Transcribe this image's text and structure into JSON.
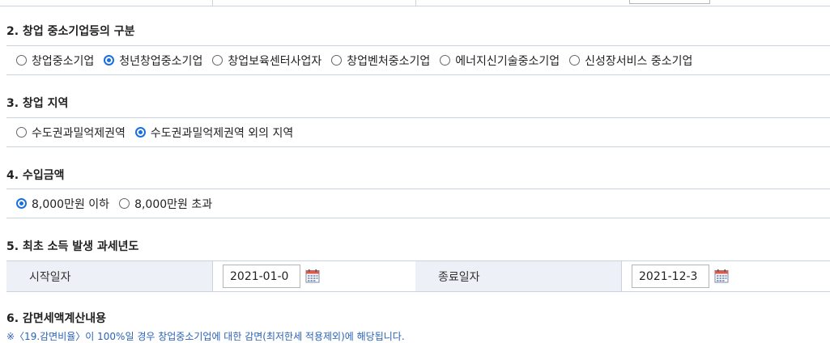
{
  "sections": [
    {
      "title": "2. 창업 중소기업등의 구분",
      "options": [
        {
          "label": "창업중소기업",
          "selected": false
        },
        {
          "label": "청년창업중소기업",
          "selected": true
        },
        {
          "label": "창업보육센터사업자",
          "selected": false
        },
        {
          "label": "창업벤처중소기업",
          "selected": false
        },
        {
          "label": "에너지신기술중소기업",
          "selected": false
        },
        {
          "label": "신성장서비스 중소기업",
          "selected": false
        }
      ]
    },
    {
      "title": "3. 창업 지역",
      "options": [
        {
          "label": "수도권과밀억제권역",
          "selected": false
        },
        {
          "label": "수도권과밀억제권역 외의 지역",
          "selected": true
        }
      ]
    },
    {
      "title": "4. 수입금액",
      "options": [
        {
          "label": "8,000만원 이하",
          "selected": true
        },
        {
          "label": "8,000만원 초과",
          "selected": false
        }
      ]
    }
  ],
  "period": {
    "title": "5. 최초 소득 발생 과세년도",
    "start_label": "시작일자",
    "start_value": "2021-01-0",
    "end_label": "종료일자",
    "end_value": "2021-12-3",
    "icon": "calendar-icon"
  },
  "calc": {
    "title": "6. 감면세액계산내용",
    "note": "※〈19.감면비율〉이 100%일 경우 창업중소기업에 대한 감면(최저한세 적용제외)에 해당됩니다."
  },
  "colors": {
    "accent": "#1a6fe0",
    "label_bg": "#edf1f7",
    "border": "#c9d3e0",
    "note": "#2a63b8"
  }
}
